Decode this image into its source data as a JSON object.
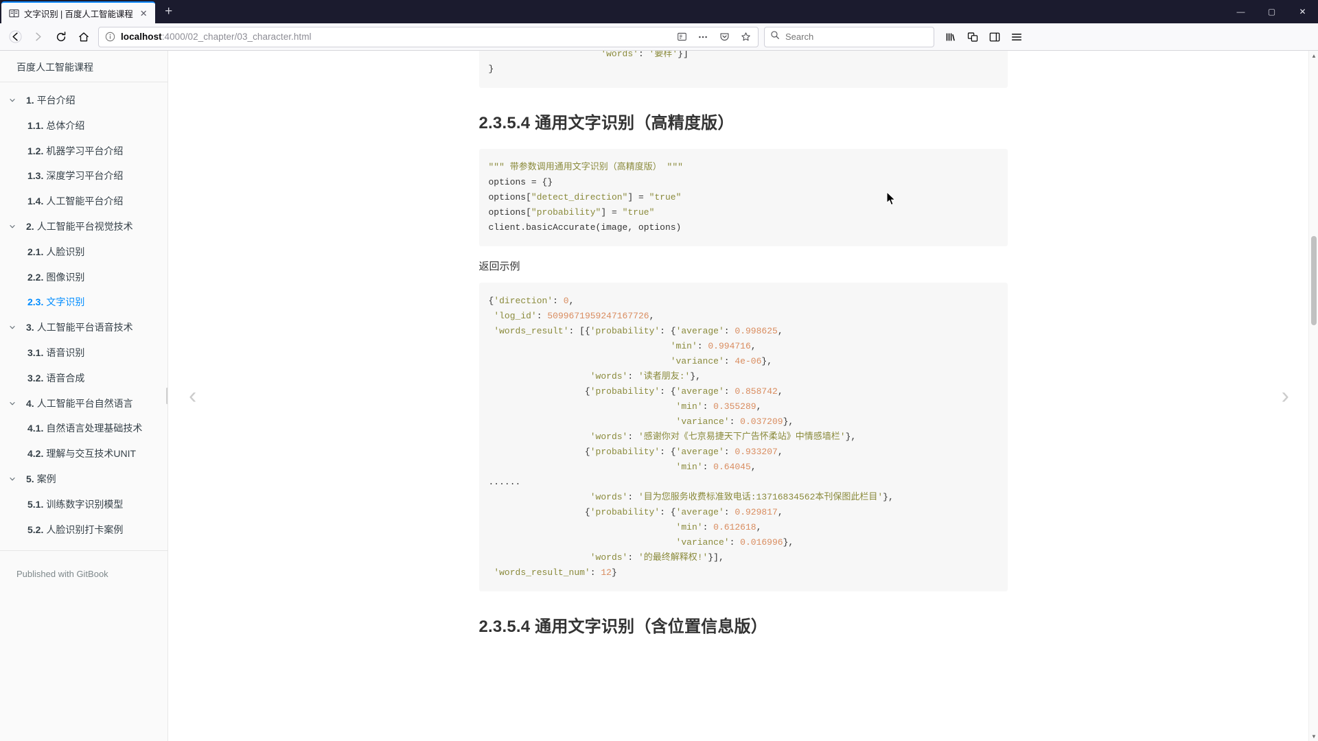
{
  "browser": {
    "tab": {
      "title": "文字识别 | 百度人工智能课程",
      "favicon_icon": "book-icon",
      "close_icon": "close-icon"
    },
    "newtab_label": "+",
    "window_controls": {
      "minimize": "—",
      "maximize": "▢",
      "close": "✕"
    },
    "nav": {
      "back_icon": "arrow-left-icon",
      "forward_icon": "arrow-right-icon",
      "reload_icon": "reload-icon",
      "home_icon": "home-icon"
    },
    "url": {
      "info_icon": "info-circle-icon",
      "host": "localhost",
      "path": ":4000/02_chapter/03_character.html",
      "reader_icon": "reader-view-icon",
      "more_icon": "ellipsis-icon",
      "pocket_icon": "pocket-icon",
      "bookmark_icon": "star-icon"
    },
    "search": {
      "icon": "search-icon",
      "placeholder": "Search"
    },
    "toolbar_right": {
      "library_icon": "library-icon",
      "container_icon": "container-tabs-icon",
      "sidebar_icon": "sidebar-icon",
      "menu_icon": "hamburger-menu-icon"
    }
  },
  "sidebar": {
    "brand": "百度人工智能课程",
    "footer": "Published with GitBook",
    "chapters": [
      {
        "num": "1.",
        "label": "平台介绍",
        "active": false,
        "items": [
          {
            "num": "1.1.",
            "label": "总体介绍",
            "active": false
          },
          {
            "num": "1.2.",
            "label": "机器学习平台介绍",
            "active": false
          },
          {
            "num": "1.3.",
            "label": "深度学习平台介绍",
            "active": false
          },
          {
            "num": "1.4.",
            "label": "人工智能平台介绍",
            "active": false
          }
        ]
      },
      {
        "num": "2.",
        "label": "人工智能平台视觉技术",
        "active": false,
        "items": [
          {
            "num": "2.1.",
            "label": "人脸识别",
            "active": false
          },
          {
            "num": "2.2.",
            "label": "图像识别",
            "active": false
          },
          {
            "num": "2.3.",
            "label": "文字识别",
            "active": true
          }
        ]
      },
      {
        "num": "3.",
        "label": "人工智能平台语音技术",
        "active": false,
        "items": [
          {
            "num": "3.1.",
            "label": "语音识别",
            "active": false
          },
          {
            "num": "3.2.",
            "label": "语音合成",
            "active": false
          }
        ]
      },
      {
        "num": "4.",
        "label": "人工智能平台自然语言",
        "active": false,
        "items": [
          {
            "num": "4.1.",
            "label": "自然语言处理基础技术",
            "active": false
          },
          {
            "num": "4.2.",
            "label": "理解与交互技术UNIT",
            "active": false
          }
        ]
      },
      {
        "num": "5.",
        "label": "案例",
        "active": false,
        "items": [
          {
            "num": "5.1.",
            "label": "训练数字识别模型",
            "active": false
          },
          {
            "num": "5.2.",
            "label": "人脸识别打卡案例",
            "active": false
          }
        ]
      }
    ]
  },
  "content": {
    "prev_arrow": "‹",
    "next_arrow": "›",
    "top_code_fragment": "                     'words': '要样'}]\n}",
    "heading_high_precision": "2.3.5.4 通用文字识别（高精度版）",
    "code_options": "\"\"\" 带参数调用通用文字识别（高精度版） \"\"\"\noptions = {}\noptions[\"detect_direction\"] = \"true\"\noptions[\"probability\"] = \"true\"\nclient.basicAccurate(image, options)",
    "return_example_label": "返回示例",
    "return_json": "{'direction': 0,\n 'log_id': 5099671959247167726,\n 'words_result': [{'probability': {'average': 0.998625,\n                                  'min': 0.994716,\n                                  'variance': 4e-06},\n                   'words': '读者朋友:'},\n                  {'probability': {'average': 0.858742,\n                                   'min': 0.355289,\n                                   'variance': 0.037209},\n                   'words': '感谢你对《七京易捷天下广告怀柔站》中情感墙栏'},\n                  {'probability': {'average': 0.933207,\n                                   'min': 0.64045,\n......\n                   'words': '目为您服务收费标准致电话:13716834562本刊保图此栏目'},\n                  {'probability': {'average': 0.929817,\n                                   'min': 0.612618,\n                                   'variance': 0.016996},\n                   'words': '的最终解释权!'}],\n 'words_result_num': 12}",
    "heading_with_position": "2.3.5.4 通用文字识别（含位置信息版）"
  },
  "colors": {
    "accent": "#008cff",
    "tab_accent": "#0a84ff",
    "chrome_bg": "#1b1b2e",
    "sidebar_bg": "#fafafa",
    "code_bg": "#f7f7f7",
    "string": "#8a8a3b",
    "number": "#d98c5f"
  }
}
